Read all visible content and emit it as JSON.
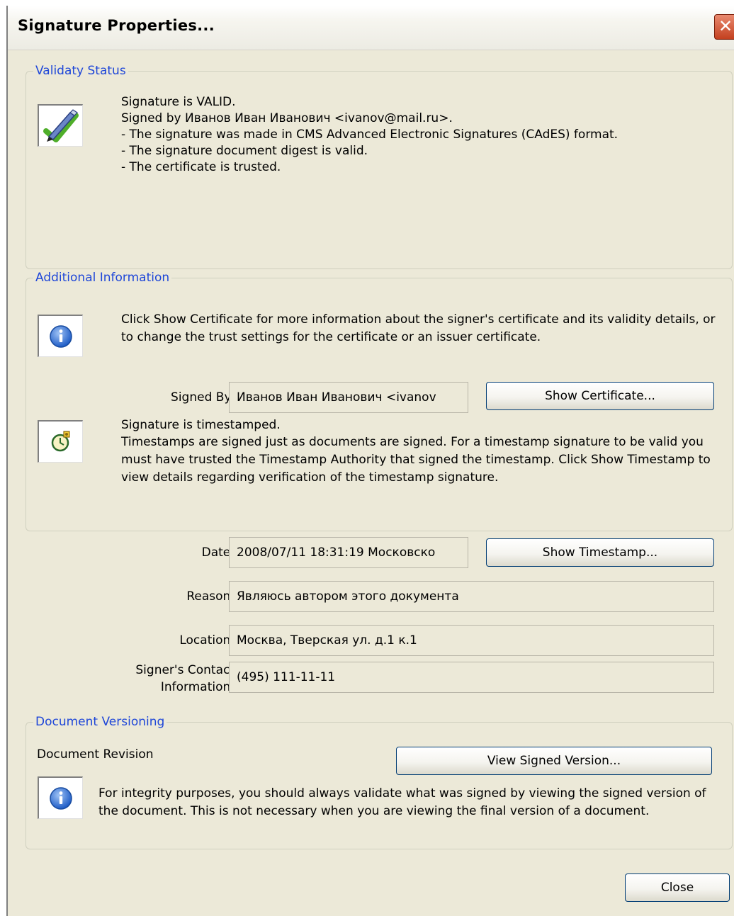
{
  "window": {
    "title": "Signature Properties...",
    "close_glyph": "✕"
  },
  "validity": {
    "legend": "Validaty Status",
    "icon": "signature-valid-pen-check-icon",
    "lines": [
      "Signature is VALID.",
      "Signed by Иванов Иван Иванович <ivanov@mail.ru>.",
      "- The signature was made in CMS Advanced Electronic Signatures (CAdES) format.",
      "- The signature document digest is valid.",
      "- The certificate is trusted."
    ]
  },
  "additional": {
    "legend": "Additional Information",
    "info_icon": "info-icon",
    "info_text": "Click Show Certificate for more information about the signer's certificate and its validity details, or to change the trust settings for the certificate or an issuer certificate.",
    "signed_by_label": "Signed By:",
    "signed_by_value": "Иванов Иван Иванович <ivanov",
    "show_certificate_button": "Show Certificate...",
    "timestamp_icon": "timestamp-clock-icon",
    "timestamp_title": "Signature is timestamped.",
    "timestamp_text": "Timestamps are signed just as documents are signed. For a timestamp signature to be valid you must have trusted  the Timestamp Authority that signed the timestamp. Click Show Timestamp to view details regarding verification of the timestamp signature.",
    "date_label": "Date:",
    "date_value": "2008/07/11 18:31:19 Московско",
    "show_timestamp_button": "Show Timestamp...",
    "reason_label": "Reason:",
    "reason_value": "Являюсь автором этого документа",
    "location_label": "Location:",
    "location_value": "Москва, Тверская ул. д.1 к.1",
    "contact_label_1": "Signer's Contact",
    "contact_label_2": "Information:",
    "contact_value": "(495) 111-11-11"
  },
  "versioning": {
    "legend": "Document Versioning",
    "revision_label": "Document Revision",
    "view_signed_button": "View Signed Version...",
    "info_icon": "info-icon",
    "info_text": "For integrity purposes, you should always validate what was signed by viewing the signed version of the document. This is not necessary when you are viewing the final version of a document."
  },
  "footer": {
    "close_button": "Close"
  },
  "colors": {
    "dialog_bg": "#ece9d8",
    "legend_blue": "#1f47d8",
    "close_red": "#c3401f"
  }
}
